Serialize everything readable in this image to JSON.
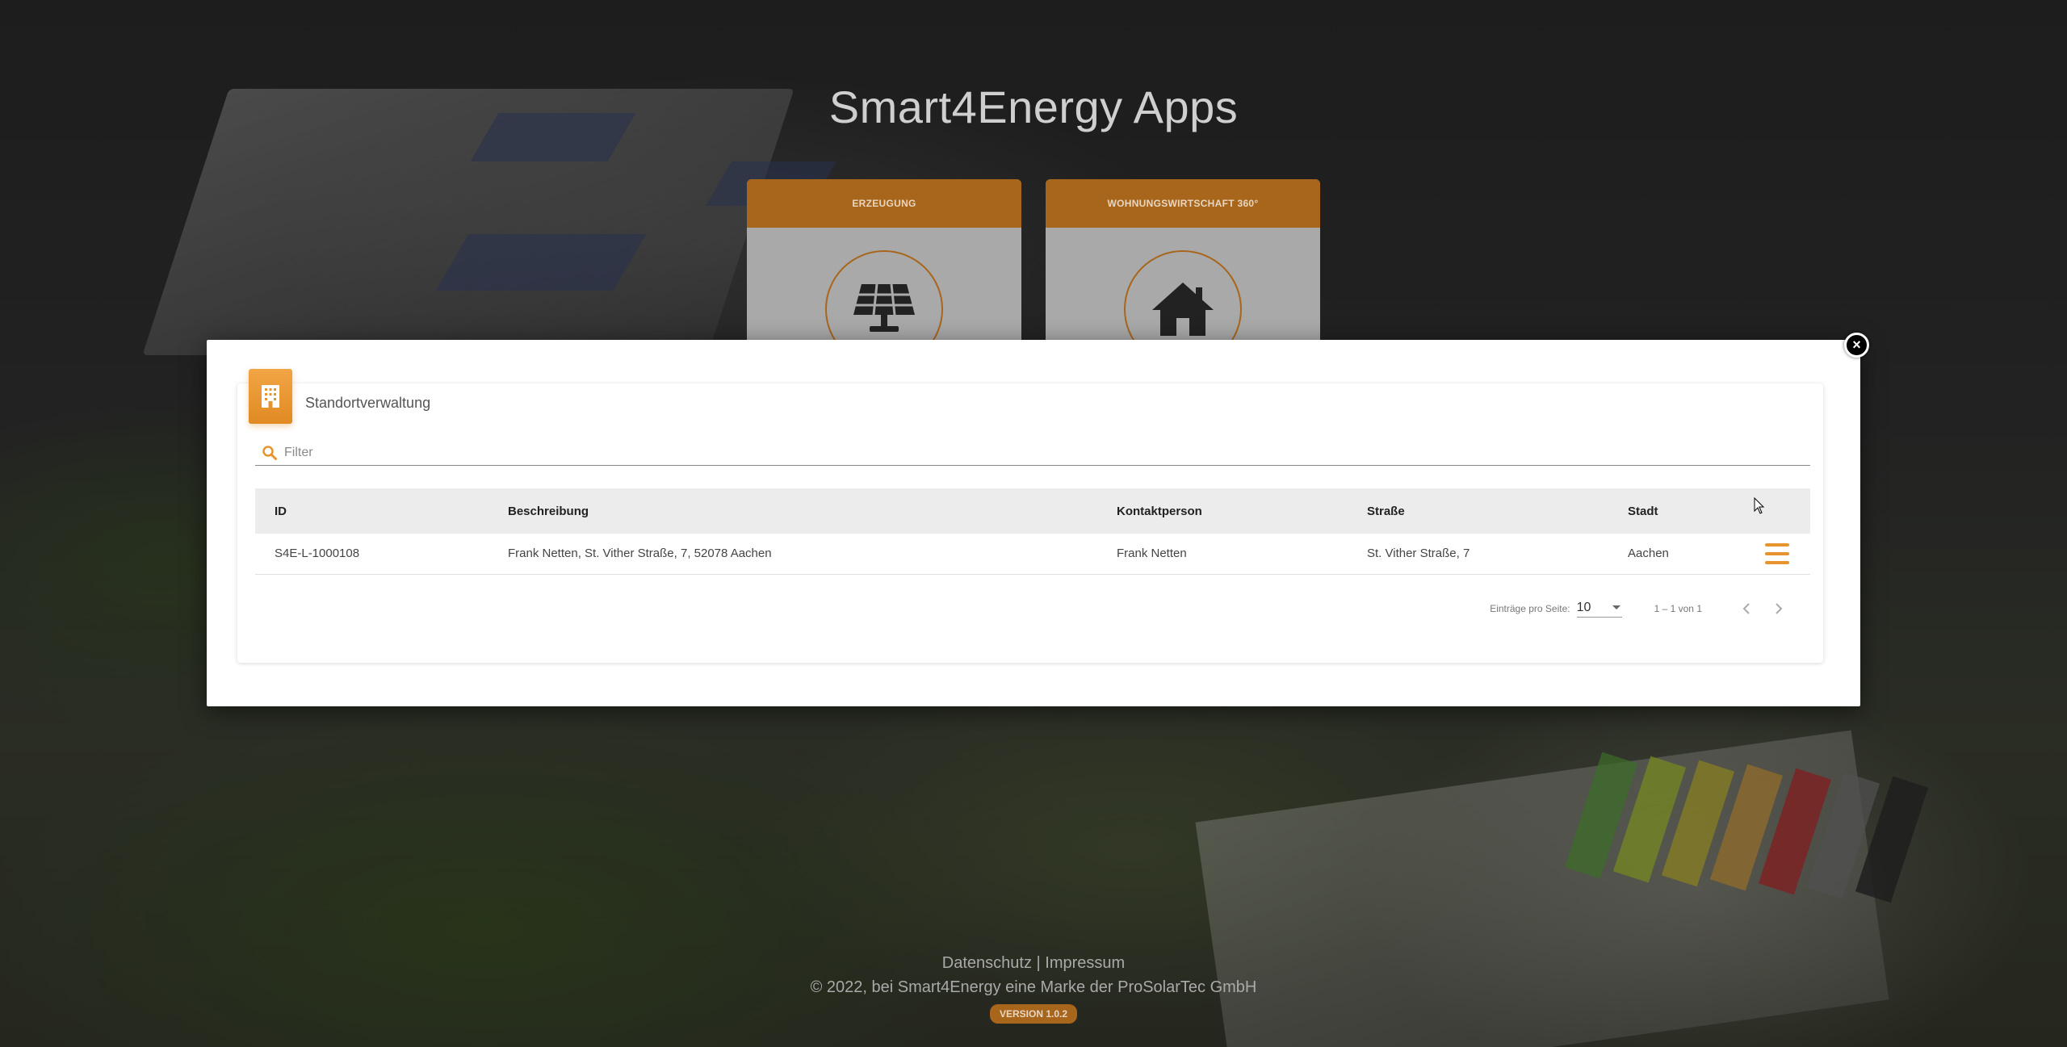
{
  "app": {
    "title": "Smart4Energy Apps"
  },
  "app_cards": [
    {
      "label": "ERZEUGUNG",
      "icon": "solar-panel-icon"
    },
    {
      "label": "WOHNUNGSWIRTSCHAFT 360°",
      "icon": "house-icon"
    }
  ],
  "modal": {
    "close_label": "×",
    "title": "Standortverwaltung",
    "header_icon": "building-icon",
    "filter": {
      "placeholder": "Filter",
      "value": ""
    },
    "table": {
      "columns": [
        "ID",
        "Beschreibung",
        "Kontaktperson",
        "Straße",
        "Stadt"
      ],
      "rows": [
        {
          "id": "S4E-L-1000108",
          "beschreibung": "Frank Netten, St. Vither Straße, 7, 52078 Aachen",
          "kontaktperson": "Frank Netten",
          "strasse": "St. Vither Straße, 7",
          "stadt": "Aachen",
          "action_icon": "hamburger-menu-icon"
        }
      ]
    },
    "paginator": {
      "page_size_label": "Einträge pro Seite:",
      "page_size": "10",
      "range_label": "1 – 1 von 1"
    }
  },
  "footer": {
    "datenschutz": "Datenschutz",
    "separator": "|",
    "impressum": "Impressum",
    "copyright": "© 2022, bei Smart4Energy eine Marke der ProSolarTec GmbH",
    "version": "VERSION 1.0.2"
  },
  "colors": {
    "accent": "#e8942e",
    "accent_dark": "#a8661c",
    "backdrop": "#1c1c1c"
  }
}
